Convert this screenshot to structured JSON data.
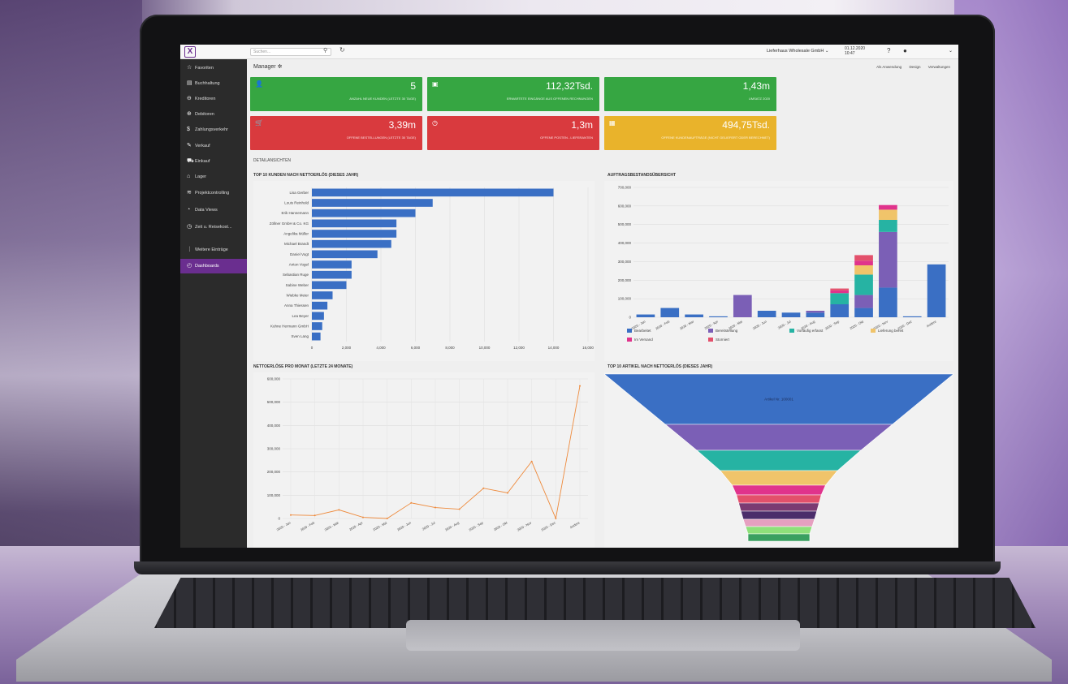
{
  "topbar": {
    "search_placeholder": "Suchen...",
    "company": "Lieferhaus Wholesale GmbH",
    "date": "01.12.2020",
    "time": "10:47"
  },
  "sidebar": {
    "items": [
      {
        "label": "Favoriten",
        "icon": "star-icon",
        "glyph": "☆"
      },
      {
        "label": "Buchhaltung",
        "icon": "ledger-icon",
        "glyph": "▤"
      },
      {
        "label": "Kreditoren",
        "icon": "minus-circle-icon",
        "glyph": "⊖"
      },
      {
        "label": "Debitoren",
        "icon": "plus-circle-icon",
        "glyph": "⊕"
      },
      {
        "label": "Zahlungsverkehr",
        "icon": "dollar-icon",
        "glyph": "$"
      },
      {
        "label": "Verkauf",
        "icon": "edit-icon",
        "glyph": "✎"
      },
      {
        "label": "Einkauf",
        "icon": "cart-icon",
        "glyph": "⛟"
      },
      {
        "label": "Lager",
        "icon": "warehouse-icon",
        "glyph": "⌂"
      },
      {
        "label": "Projektcontrolling",
        "icon": "project-icon",
        "glyph": "≋"
      },
      {
        "label": "Data Views",
        "icon": "data-views-icon",
        "glyph": "◔"
      },
      {
        "label": "Zeit u. Reisekost...",
        "icon": "timer-icon",
        "glyph": "◷"
      },
      {
        "label": "Weitere Einträge",
        "icon": "list-icon",
        "glyph": "⋮"
      },
      {
        "label": "Dashboards",
        "icon": "dashboard-icon",
        "glyph": "◴"
      }
    ]
  },
  "page": {
    "title": "Manager",
    "actions": [
      "Als Anwendung",
      "Design",
      "Verwaltungen"
    ],
    "detail_label": "DETAILANSICHTEN"
  },
  "kpis": [
    {
      "value": "5",
      "label": "ANZAHL NEUE KUNDEN (LETZTE 30 TAGE)",
      "color": "#36a642",
      "icon": "user-icon",
      "glyph": "👤"
    },
    {
      "value": "112,32Tsd.",
      "label": "ERWARTETE EINGÄNGE AUS OFFENEN RECHNUNGEN",
      "color": "#36a642",
      "icon": "invoice-icon",
      "glyph": "▣"
    },
    {
      "value": "1,43m",
      "label": "UMSATZ 2020",
      "color": "#36a642",
      "icon": "",
      "glyph": ""
    },
    {
      "value": "3,39m",
      "label": "OFFENE BESTELLUNGEN (LETZTE 30 TAGE)",
      "color": "#d93a3e",
      "icon": "cart-icon",
      "glyph": "🛒"
    },
    {
      "value": "1,3m",
      "label": "OFFENE POSTEN - LIEFERANTEN",
      "color": "#d93a3e",
      "icon": "clock-icon",
      "glyph": "◷"
    },
    {
      "value": "494,75Tsd.",
      "label": "OFFENE KUNDENAUFTRÄGE (NICHT GELIEFERT ODER BERECHNET)",
      "color": "#e9b32b",
      "icon": "calculator-icon",
      "glyph": "▦"
    }
  ],
  "chart_data": [
    {
      "type": "bar",
      "orientation": "horizontal",
      "title": "TOP 10 KUNDEN NACH NETTOERLÖS (DIESES JAHR)",
      "categories": [
        "Lisa Gerber",
        "Louis Reinhold",
        "Erik Hannemann",
        "Zöllner GmbH & Co. KG",
        "Angelika Müller",
        "Michael Brandt",
        "Daniel Vogt",
        "Anton Vogel",
        "Sebastian Ruge",
        "Sabine Weber",
        "Wiebke Meier",
        "Anna Thiessen",
        "Lea Beyer",
        "Kuhne Hermann GmbH",
        "Sven Lang"
      ],
      "values": [
        14000,
        7000,
        6000,
        4900,
        4900,
        4600,
        3800,
        2300,
        2300,
        2000,
        1200,
        900,
        700,
        600,
        500
      ],
      "ticks": [
        "0",
        "2,000",
        "4,000",
        "6,000",
        "8,000",
        "10,000",
        "12,000",
        "14,000",
        "16,000"
      ],
      "xlim": [
        0,
        16000
      ],
      "color": "#3a6fc4"
    },
    {
      "type": "bar",
      "stacked": true,
      "title": "AUFTRAGSBESTANDSÜBERSICHT",
      "categories": [
        "2020 - Jan",
        "2020 - Feb",
        "2020 - Mar",
        "2020 - Apr",
        "2020 - Mai",
        "2020 - Jun",
        "2020 - Jul",
        "2020 - Aug",
        "2020 - Sep",
        "2020 - Okt",
        "2020 - Nov",
        "2020 - Dez",
        "Andere"
      ],
      "y_ticks": [
        "0",
        "100,000",
        "200,000",
        "300,000",
        "400,000",
        "500,000",
        "600,000",
        "700,000"
      ],
      "ylim": [
        0,
        700000
      ],
      "series": [
        {
          "name": "Bearbeitet",
          "color": "#3a6fc4",
          "values": [
            15000,
            50000,
            15000,
            5000,
            0,
            35000,
            25000,
            25000,
            70000,
            50000,
            160000,
            5000,
            285000
          ]
        },
        {
          "name": "Bereitstellung",
          "color": "#7b5fb6",
          "values": [
            0,
            0,
            0,
            0,
            120000,
            0,
            0,
            10000,
            0,
            70000,
            300000,
            0,
            0
          ]
        },
        {
          "name": "Vorläufig erfasst",
          "color": "#26b3a3",
          "values": [
            0,
            0,
            0,
            0,
            0,
            0,
            0,
            0,
            60000,
            110000,
            65000,
            0,
            0
          ]
        },
        {
          "name": "Lieferung bereit",
          "color": "#f0c46a",
          "values": [
            0,
            0,
            0,
            0,
            0,
            0,
            0,
            0,
            0,
            50000,
            55000,
            0,
            0
          ]
        },
        {
          "name": "Im Versand",
          "color": "#e0338c",
          "values": [
            0,
            0,
            0,
            0,
            0,
            0,
            0,
            0,
            15000,
            25000,
            25000,
            0,
            0
          ]
        },
        {
          "name": "Storniert",
          "color": "#e3506b",
          "values": [
            0,
            0,
            0,
            0,
            0,
            0,
            0,
            0,
            10000,
            30000,
            0,
            0,
            0
          ]
        }
      ]
    },
    {
      "type": "line",
      "title": "NETTOERLÖSE PRO MONAT (LETZTE 24 MONATE)",
      "categories": [
        "2020 - Jan",
        "2020 - Feb",
        "2020 - Mär",
        "2020 - Apr",
        "2020 - Mai",
        "2020 - Jun",
        "2020 - Jul",
        "2020 - Aug",
        "2020 - Sep",
        "2020 - Okt",
        "2020 - Nov",
        "2020 - Dez",
        "Andere"
      ],
      "values": [
        15000,
        13000,
        37000,
        5000,
        0,
        67000,
        47000,
        40000,
        130000,
        110000,
        245000,
        0,
        570000
      ],
      "y_ticks": [
        "0",
        "100,000",
        "200,000",
        "300,000",
        "400,000",
        "500,000",
        "600,000"
      ],
      "ylim": [
        0,
        600000
      ],
      "color": "#ee8a3c"
    },
    {
      "type": "funnel",
      "title": "TOP 10 ARTIKEL NACH NETTOERLÖS (DIESES JAHR)",
      "segments": [
        {
          "label": "Artikel Nr. 100001",
          "value": 100,
          "color": "#3a6fc4"
        },
        {
          "label": "",
          "value": 55,
          "color": "#7b5fb6"
        },
        {
          "label": "",
          "value": 35,
          "color": "#26b3a3"
        },
        {
          "label": "",
          "value": 22,
          "color": "#f0c46a"
        },
        {
          "label": "",
          "value": 16,
          "color": "#e0338c"
        },
        {
          "label": "",
          "value": 14,
          "color": "#e3506b"
        },
        {
          "label": "",
          "value": 13,
          "color": "#7b3b72"
        },
        {
          "label": "",
          "value": 12,
          "color": "#4b2d6b"
        },
        {
          "label": "",
          "value": 11,
          "color": "#e6a0c0"
        },
        {
          "label": "",
          "value": 10,
          "color": "#8ee07a"
        },
        {
          "label": "",
          "value": 9,
          "color": "#3aa060"
        }
      ]
    }
  ]
}
